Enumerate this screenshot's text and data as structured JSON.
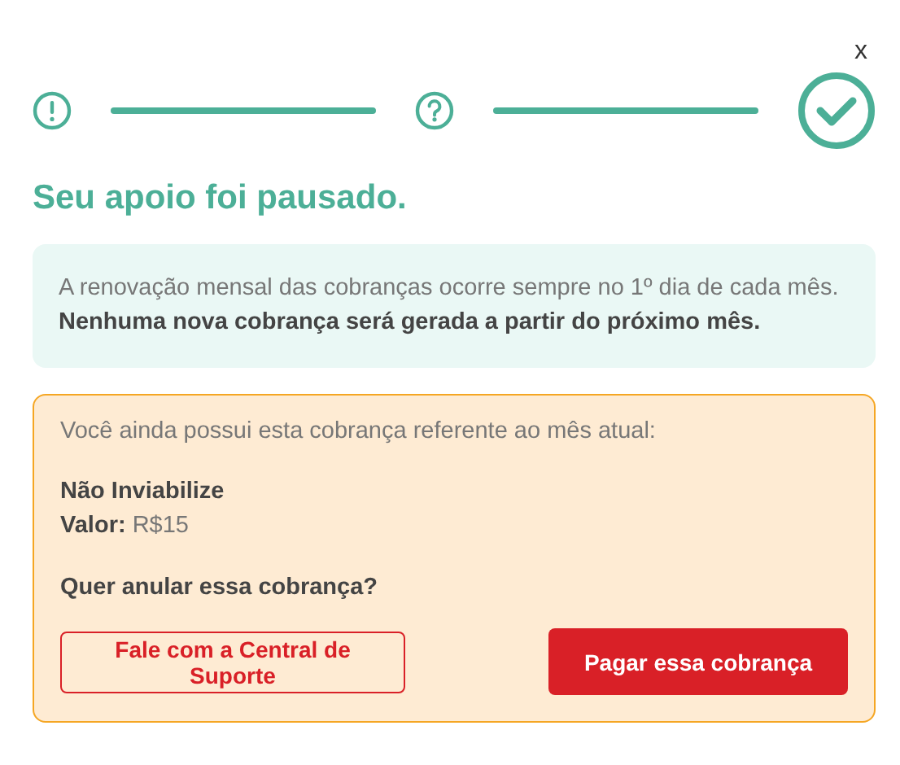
{
  "close": "x",
  "steps": [
    {
      "kind": "alert"
    },
    {
      "kind": "question"
    },
    {
      "kind": "done"
    }
  ],
  "title": "Seu apoio foi pausado.",
  "info": "A renovação mensal das cobranças ocorre sempre no 1º dia de cada mês. **Nenhuma nova cobrança será gerada a partir do próximo mês.**",
  "charge": {
    "intro": "Você ainda possui esta cobrança referente ao mês atual:",
    "name": "Não Inviabilize",
    "value": "**Valor:** R$15",
    "question": "Quer anular essa cobrança?",
    "buttons": [
      {
        "kind": "outline",
        "label": "Fale com a Central de Suporte"
      },
      {
        "kind": "primary",
        "label": "Pagar essa cobrança"
      }
    ]
  }
}
